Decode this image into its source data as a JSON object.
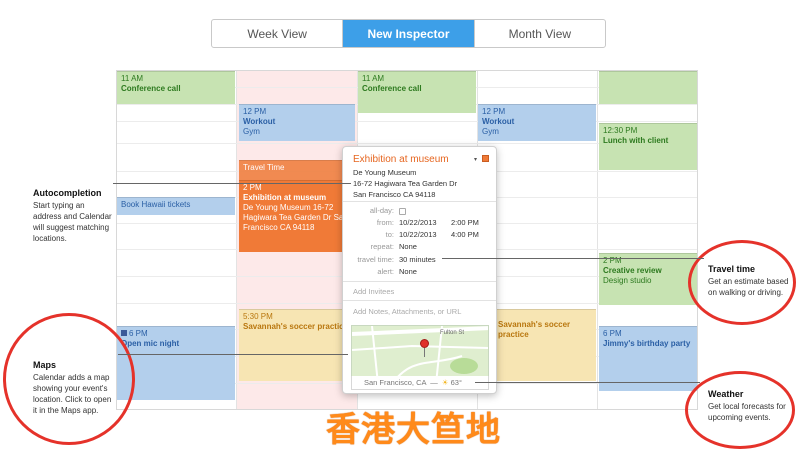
{
  "tabs": [
    {
      "label": "Week View"
    },
    {
      "label": "New Inspector"
    },
    {
      "label": "Month View"
    }
  ],
  "events": {
    "col3_conference": {
      "time": "11 AM",
      "title": "Conference call"
    },
    "col1_conference": {
      "time": "11 AM",
      "title": "Conference call"
    },
    "col2_workout": {
      "time": "12 PM",
      "title": "Workout",
      "sub": "Gym"
    },
    "col4_workout": {
      "time": "12 PM",
      "title": "Workout",
      "sub": "Gym"
    },
    "col5_lunch": {
      "time": "12:30 PM",
      "title": "Lunch with client"
    },
    "col2_travel": {
      "label": "Travel Time"
    },
    "col2_exhibition": {
      "time": "2 PM",
      "title": "Exhibition at museum",
      "addr": "De Young Museum 16-72 Hagiwara Tea Garden Dr San Francisco CA 94118"
    },
    "col1_hawaii": {
      "title": "Book Hawaii tickets"
    },
    "col5_creative": {
      "time": "2 PM",
      "title": "Creative review",
      "sub": "Design studio"
    },
    "col2_soccer": {
      "time": "5:30 PM",
      "title": "Savannah's soccer practice"
    },
    "col4_soccer": {
      "title": "Savannah's soccer practice"
    },
    "col1_openmic": {
      "time": "6 PM",
      "title": "Open mic night"
    },
    "col5_birthday": {
      "time": "6 PM",
      "title": "Jimmy's birthday party"
    }
  },
  "inspector": {
    "title": "Exhibition at museum",
    "address_lines": [
      "De Young Museum",
      "16-72 Hagiwara Tea Garden Dr",
      "San Francisco CA 94118"
    ],
    "fields": {
      "allday_label": "all-day:",
      "from_label": "from:",
      "from_date": "10/22/2013",
      "from_time": "2:00 PM",
      "to_label": "to:",
      "to_date": "10/22/2013",
      "to_time": "4:00 PM",
      "repeat_label": "repeat:",
      "repeat_value": "None",
      "travel_label": "travel time:",
      "travel_value": "30 minutes",
      "alert_label": "alert:",
      "alert_value": "None"
    },
    "invitees_placeholder": "Add Invitees",
    "notes_placeholder": "Add Notes, Attachments, or URL",
    "map_street": "Fulton St",
    "weather": {
      "city": "San Francisco, CA",
      "sep": "—",
      "temp": "63°"
    }
  },
  "annotations": {
    "autocompletion": {
      "title": "Autocompletion",
      "body": "Start typing an address and Calendar will suggest matching locations."
    },
    "maps": {
      "title": "Maps",
      "body": "Calendar adds a map showing your event's location. Click to open it in the Maps app."
    },
    "travel_time": {
      "title": "Travel time",
      "body": "Get an estimate based on walking or driving."
    },
    "weather": {
      "title": "Weather",
      "body": "Get local forecasts for upcoming events."
    }
  },
  "watermark": "香港大笪地",
  "colors": {
    "accent": "#3d9fe8",
    "event_orange": "#f07a37",
    "annotation_circle": "#e5322a",
    "watermark": "#ff8a1a"
  }
}
